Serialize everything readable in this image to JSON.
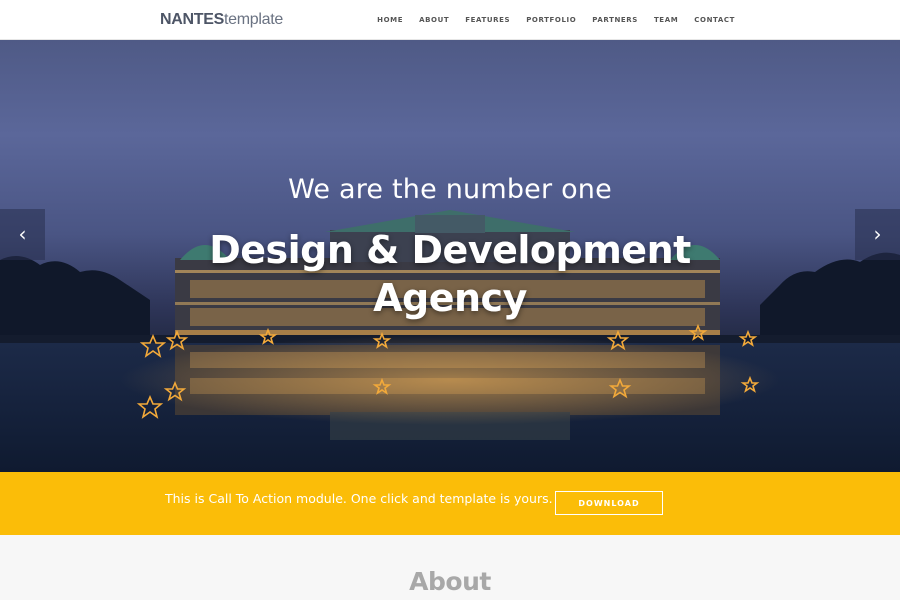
{
  "brand": {
    "bold": "NANTES",
    "light": "template"
  },
  "nav": {
    "items": [
      {
        "label": "HOME"
      },
      {
        "label": "ABOUT"
      },
      {
        "label": "FEATURES"
      },
      {
        "label": "PORTFOLIO"
      },
      {
        "label": "PARTNERS"
      },
      {
        "label": "TEAM"
      },
      {
        "label": "CONTACT"
      }
    ]
  },
  "hero": {
    "subtitle": "We are the number one",
    "title_line1": "Design & Development",
    "title_line2": "Agency",
    "prev_icon": "chevron-left-icon",
    "next_icon": "chevron-right-icon",
    "prev_glyph": "‹",
    "next_glyph": "›"
  },
  "cta": {
    "text": "This is Call To Action module. One click and template is yours.",
    "button_label": "DOWNLOAD",
    "background": "#fbbd08"
  },
  "about": {
    "heading": "About"
  }
}
